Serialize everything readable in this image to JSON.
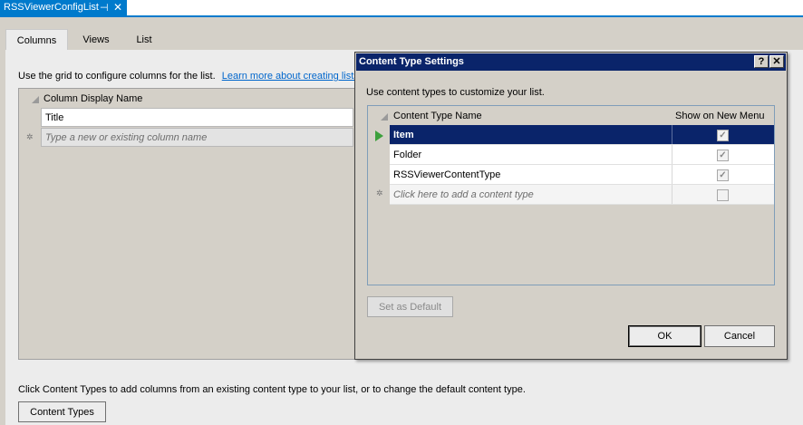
{
  "document_tab": {
    "title": "RSSViewerConfigList",
    "pin_icon": "pin-icon",
    "close_icon": "close-icon"
  },
  "tabs": [
    {
      "label": "Columns",
      "active": true
    },
    {
      "label": "Views",
      "active": false
    },
    {
      "label": "List",
      "active": false
    }
  ],
  "columns": {
    "instruction": "Use the grid to configure columns for the list.",
    "learn_more_link": "Learn more about creating lists",
    "grid": {
      "header": "Column Display Name",
      "rows": [
        "Title"
      ],
      "new_row_placeholder": "Type a new or existing column name"
    },
    "bottom_text": "Click Content Types to add columns from an existing content type to your list, or to change the default content type.",
    "content_types_button": "Content Types"
  },
  "dialog": {
    "title": "Content Type Settings",
    "help_button": "?",
    "close_button": "✕",
    "description": "Use content types to customize your list.",
    "grid": {
      "headers": [
        "Content Type Name",
        "Show on New Menu"
      ],
      "rows": [
        {
          "name": "Item",
          "checked": true,
          "selected": true
        },
        {
          "name": "Folder",
          "checked": true,
          "selected": false
        },
        {
          "name": "RSSViewerContentType",
          "checked": true,
          "selected": false
        }
      ],
      "new_row_placeholder": "Click here to add a content type"
    },
    "set_default_button": "Set as Default",
    "ok_button": "OK",
    "cancel_button": "Cancel"
  },
  "colors": {
    "accent": "#007acc",
    "selection": "#0a246a",
    "link": "#0066cc"
  }
}
